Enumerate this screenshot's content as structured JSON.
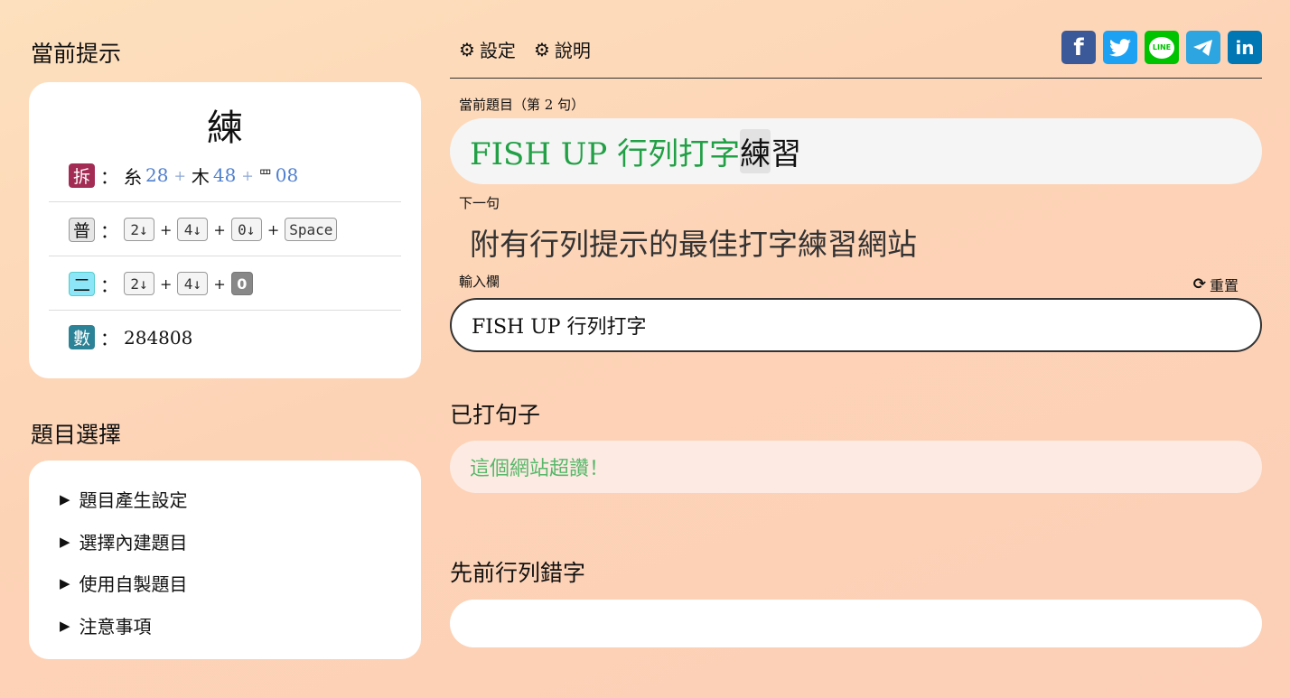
{
  "left": {
    "hint_title": "當前提示",
    "hint": {
      "char": "練",
      "chai_tag": "拆",
      "chai_parts": [
        {
          "part": "糸",
          "num": "28"
        },
        {
          "part": "木",
          "num": "48"
        },
        {
          "part": "罒",
          "num": "08"
        }
      ],
      "pu_tag": "普",
      "pu_keys": [
        "2↓",
        "4↓",
        "0↓",
        "Space"
      ],
      "er_tag": "二",
      "er_keys": [
        "2↓",
        "4↓",
        "0"
      ],
      "shu_tag": "數",
      "shu_value": "284808",
      "colon": "："
    },
    "topic_title": "題目選擇",
    "topic_items": [
      "題目產生設定",
      "選擇內建題目",
      "使用自製題目",
      "注意事項"
    ]
  },
  "right": {
    "nav": {
      "settings": "設定",
      "help": "說明"
    },
    "social": [
      "facebook-icon",
      "twitter-icon",
      "line-icon",
      "telegram-icon",
      "linkedin-icon"
    ],
    "social_labels": {
      "facebook": "f",
      "line": "LINE",
      "linkedin": "in"
    },
    "current_label": "當前題目（第 2 句）",
    "current": {
      "typed": "FISH UP 行列打字",
      "current_char": "練",
      "rest": "習"
    },
    "next_label": "下一句",
    "next_text": "附有行列提示的最佳打字練習網站",
    "input_label": "輸入欄",
    "reset_label": "重置",
    "input_value": "FISH UP 行列打字",
    "done_title": "已打句子",
    "done_text": "這個網站超讚！",
    "mistake_title": "先前行列錯字"
  },
  "colors": {
    "typed": "#21a045",
    "chai_tag": "#a32c54",
    "er_tag": "#8de6f8",
    "shu_tag": "#2c8296",
    "num": "#4f7fcf",
    "facebook": "#3b5998",
    "twitter": "#1da1f2",
    "line": "#00c300",
    "telegram": "#2ca5e0",
    "linkedin": "#0077b5"
  }
}
